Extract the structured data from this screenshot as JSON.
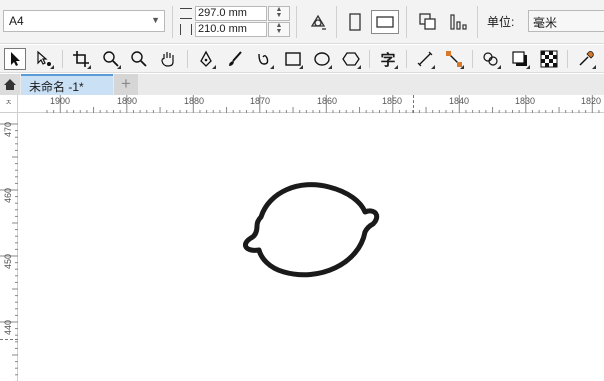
{
  "property_bar": {
    "page_size": "A4",
    "height_value": "297.0 mm",
    "width_value": "210.0 mm",
    "unit_label": "单位:",
    "unit_value": "毫米"
  },
  "tabs": {
    "document_tab": "未命名 -1*",
    "add_tab": "+"
  },
  "rulers": {
    "corner_label": "ㅈ",
    "horizontal": [
      "1900",
      "1890",
      "1880",
      "1870",
      "1860",
      "1850",
      "1840",
      "1830",
      "1820"
    ],
    "vertical": [
      "470",
      "460",
      "450",
      "440"
    ]
  },
  "toolbox": {
    "text_tool_glyph": "字"
  },
  "icons": {
    "pointer": "pointer-icon",
    "shape": "shape-edit-icon",
    "crop": "crop-icon",
    "zoom": "zoom-icon",
    "pan": "pan-hand-icon",
    "pen": "pen-icon",
    "brush": "brush-icon",
    "curve": "curve-icon",
    "rectangle": "rectangle-icon",
    "ellipse": "ellipse-icon",
    "polygon": "polygon-icon",
    "line": "line-connector-icon",
    "connector": "connector-icon",
    "blend": "blend-icon",
    "shadow": "shadow-icon",
    "transparency": "transparency-icon",
    "eyedropper": "eyedropper-icon"
  }
}
